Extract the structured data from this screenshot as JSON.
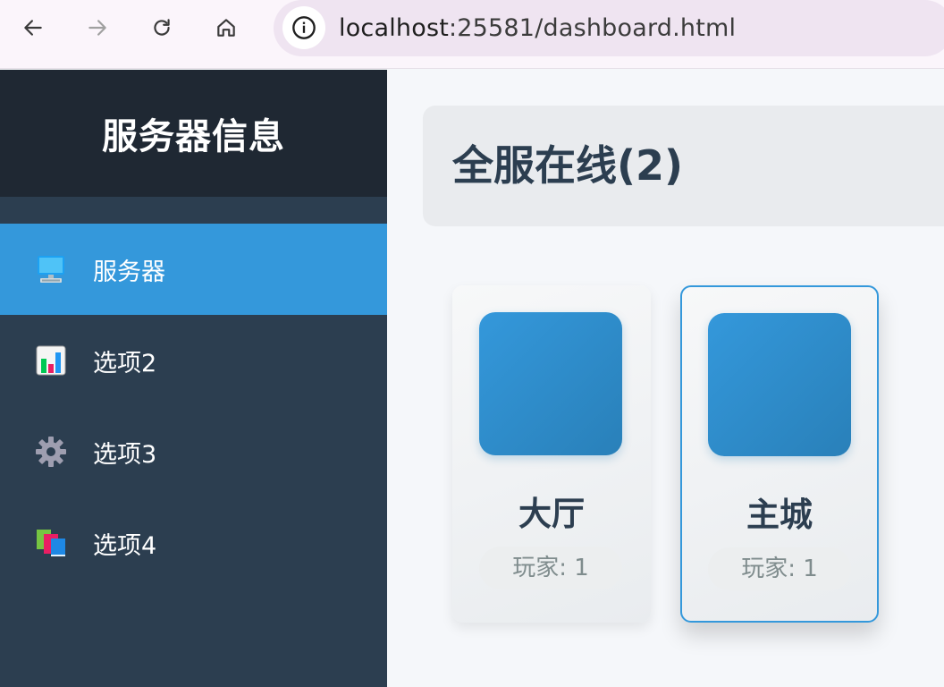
{
  "browser": {
    "url_host": "localhost",
    "url_rest": ":25581/dashboard.html"
  },
  "sidebar": {
    "title": "服务器信息",
    "items": [
      {
        "label": "服务器",
        "icon": "computer-icon",
        "active": true
      },
      {
        "label": "选项2",
        "icon": "bar-chart-icon",
        "active": false
      },
      {
        "label": "选项3",
        "icon": "gear-icon",
        "active": false
      },
      {
        "label": "选项4",
        "icon": "books-icon",
        "active": false
      }
    ]
  },
  "main": {
    "title": "全服在线(2)",
    "servers": [
      {
        "name": "大厅",
        "players": "玩家: 1",
        "selected": false
      },
      {
        "name": "主城",
        "players": "玩家: 1",
        "selected": true
      }
    ]
  },
  "colors": {
    "sidebar_bg": "#2c3e50",
    "sidebar_header_bg": "#1f2833",
    "accent": "#3498db",
    "text_dark": "#2c3e50",
    "text_muted": "#7f8c8d"
  }
}
